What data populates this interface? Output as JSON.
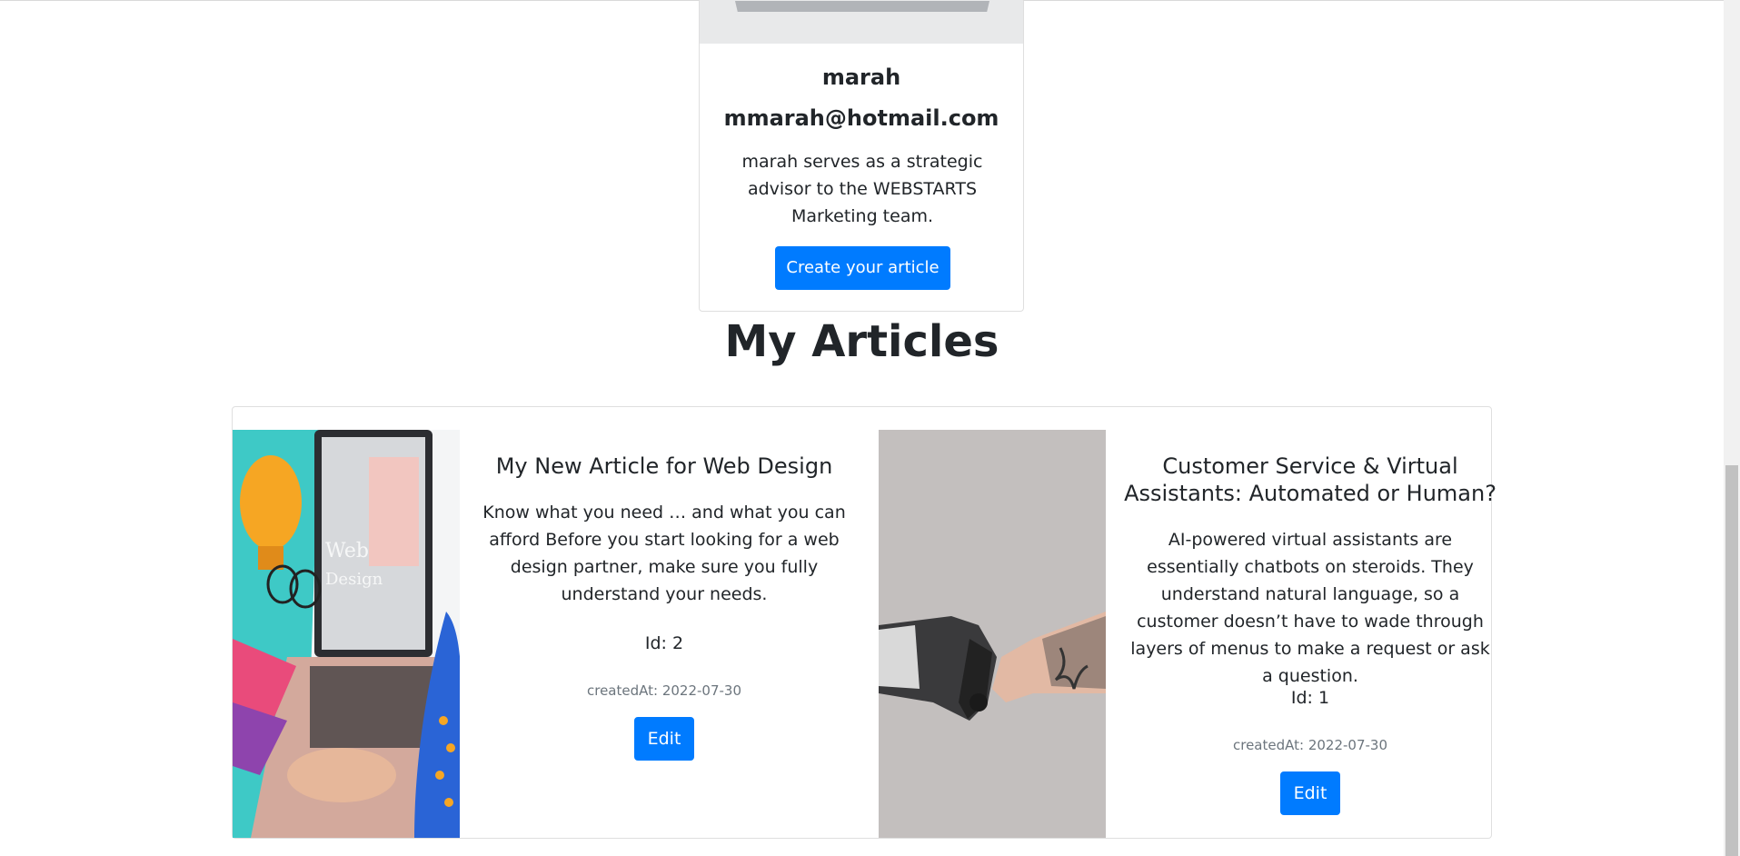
{
  "profile": {
    "name": "marah",
    "email": "mmarah@hotmail.com",
    "bio": "marah serves as a strategic advisor to the WEBSTARTS Marketing team.",
    "create_button": "Create your article"
  },
  "section_title": "My Articles",
  "articles": [
    {
      "title": "My New Article for Web Design",
      "text": "Know what you need … and what you can afford Before you start looking for a web design partner, make sure you fully understand your needs.",
      "id_label": "Id: 2",
      "created": "createdAt: 2022-07-30",
      "edit_label": "Edit",
      "image": "laptop-web-design-image"
    },
    {
      "title": "Customer Service & Virtual Assistants: Automated or Human?",
      "text": "AI-powered virtual assistants are essentially chatbots on steroids. They understand natural language, so a customer doesn’t have to wade through layers of menus to make a request or ask a question.",
      "id_label": "Id: 1",
      "created": "createdAt: 2022-07-30",
      "edit_label": "Edit",
      "image": "robot-human-fist-bump-image"
    }
  ],
  "colors": {
    "primary": "#007bff",
    "text": "#212529",
    "muted": "#6c757d"
  }
}
